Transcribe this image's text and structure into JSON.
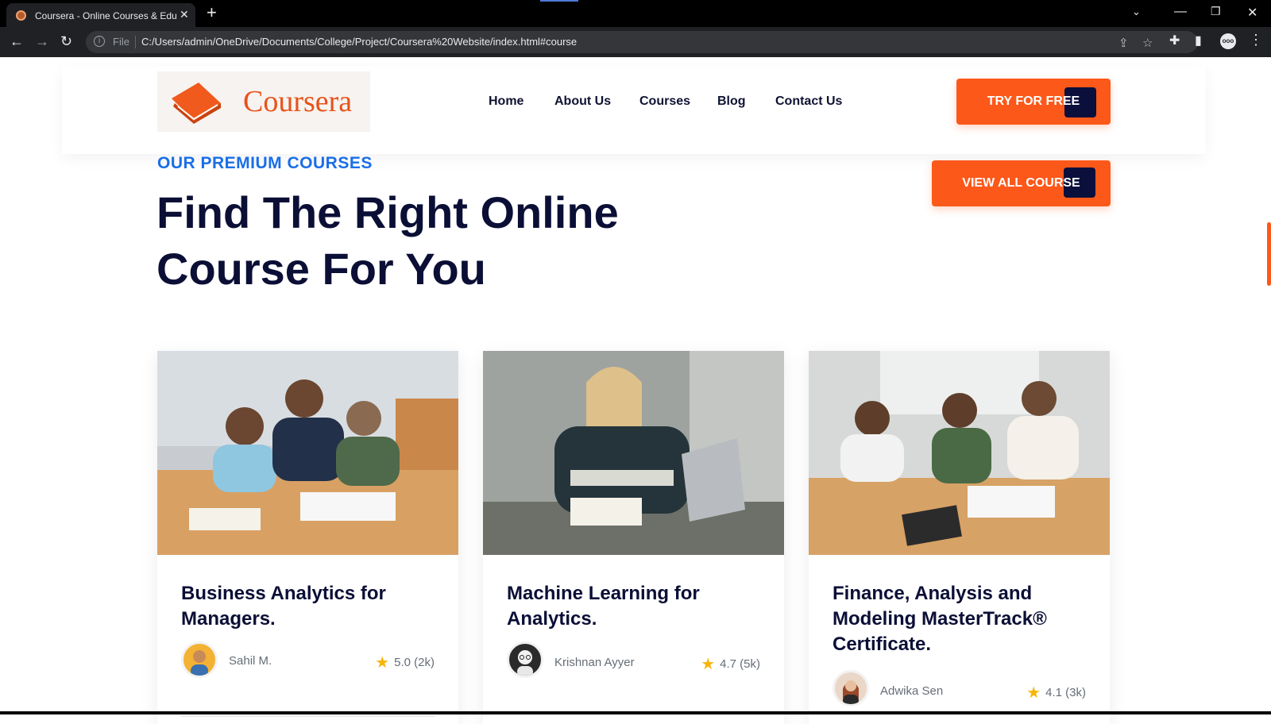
{
  "browser": {
    "tab_title": "Coursera - Online Courses & Edu",
    "tab_close": "✕",
    "new_tab": "+",
    "address_prefix": "File",
    "url": "C:/Users/admin/OneDrive/Documents/College/Project/Coursera%20Website/index.html#course",
    "profile_initials": "ooo"
  },
  "header": {
    "brand": "Coursera",
    "nav": [
      "Home",
      "About Us",
      "Courses",
      "Blog",
      "Contact Us"
    ],
    "cta_label": "TRY FOR FREE"
  },
  "section": {
    "eyebrow": "OUR PREMIUM COURSES",
    "headline_line1": "Find The Right Online",
    "headline_line2": "Course For You",
    "view_all_label": "VIEW ALL COURSE"
  },
  "courses": [
    {
      "title": "Business Analytics for Managers.",
      "author": "Sahil M.",
      "rating": "5.0 (2k)"
    },
    {
      "title": "Machine Learning for Analytics.",
      "author": "Krishnan Ayyer",
      "rating": "4.7 (5k)"
    },
    {
      "title": "Finance, Analysis and Modeling MasterTrack® Certificate.",
      "author": "Adwika Sen",
      "rating": "4.1 (3k)"
    }
  ],
  "colors": {
    "accent": "#fc581a",
    "navy": "#0b0f36",
    "eyebrow_blue": "#1a6ee8",
    "star": "#f5b50a"
  }
}
